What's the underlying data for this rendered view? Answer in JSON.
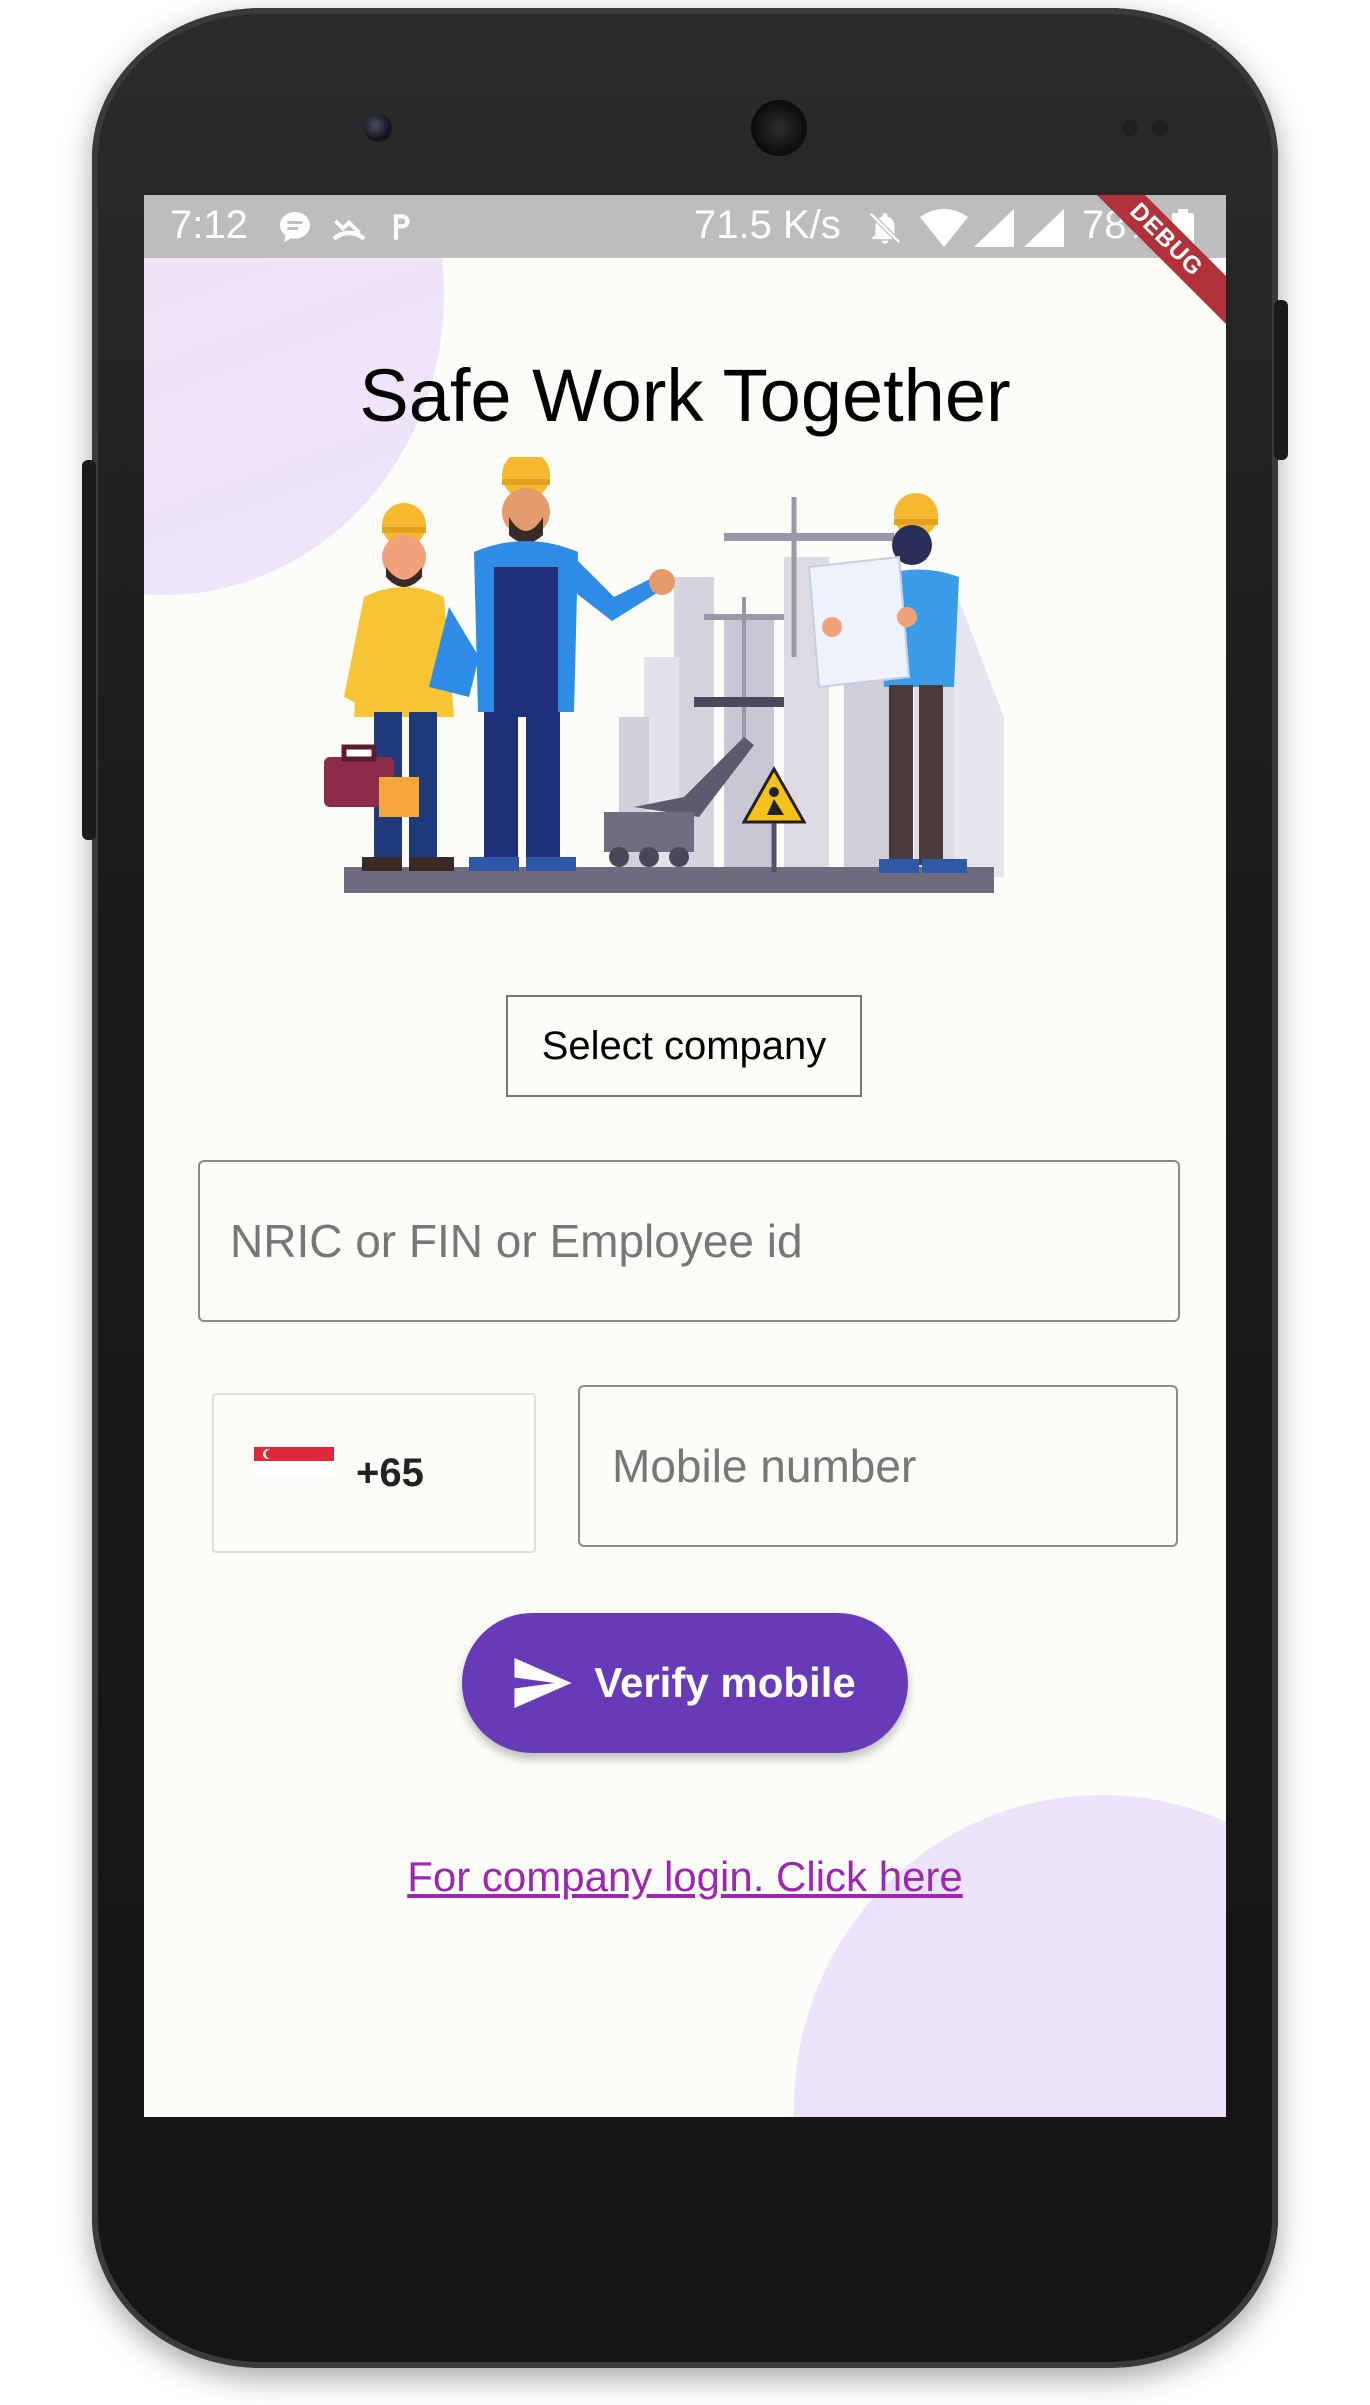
{
  "status_bar": {
    "time": "7:12",
    "network_speed": "71.5 K/s",
    "battery": "78%",
    "icons": [
      "chat-icon",
      "missed-call-icon",
      "parking-icon",
      "mute-icon",
      "wifi-icon",
      "signal-icon"
    ]
  },
  "debug_banner": "DEBUG",
  "header": {
    "title": "Safe Work Together"
  },
  "form": {
    "company_select_label": "Select company",
    "id_field_placeholder": "NRIC or FIN or Employee id",
    "country_code": "+65",
    "country_flag": "singapore-flag-icon",
    "mobile_placeholder": "Mobile number",
    "verify_button_label": "Verify mobile",
    "verify_icon": "send-icon"
  },
  "footer": {
    "company_login_link": "For company login. Click here"
  },
  "colors": {
    "primary": "#673ab7",
    "link": "#9c27b0",
    "status_bar": "#bdbdbd",
    "background": "#fcfdf8",
    "debug_banner": "#b1323b"
  }
}
